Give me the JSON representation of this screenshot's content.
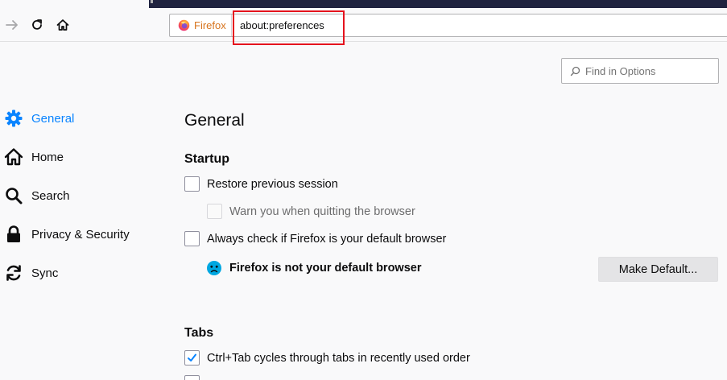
{
  "toolbar": {
    "identity_label": "Firefox",
    "url": "about:preferences"
  },
  "search": {
    "placeholder": "Find in Options"
  },
  "sidebar": {
    "items": [
      {
        "label": "General",
        "icon": "gear-icon",
        "selected": true
      },
      {
        "label": "Home",
        "icon": "home-icon",
        "selected": false
      },
      {
        "label": "Search",
        "icon": "search-icon",
        "selected": false
      },
      {
        "label": "Privacy & Security",
        "icon": "lock-icon",
        "selected": false
      },
      {
        "label": "Sync",
        "icon": "sync-icon",
        "selected": false
      }
    ]
  },
  "main": {
    "title": "General",
    "startup": {
      "heading": "Startup",
      "restore_session": "Restore previous session",
      "warn_quit": "Warn you when quitting the browser",
      "always_check": "Always check if Firefox is your default browser",
      "not_default": "Firefox is not your default browser",
      "make_default": "Make Default..."
    },
    "tabs": {
      "heading": "Tabs",
      "ctrl_tab": "Ctrl+Tab cycles through tabs in recently used order"
    }
  },
  "colors": {
    "accent": "#0a84ff",
    "highlight_box": "#e5121d",
    "firefox_orange": "#d7731c"
  }
}
